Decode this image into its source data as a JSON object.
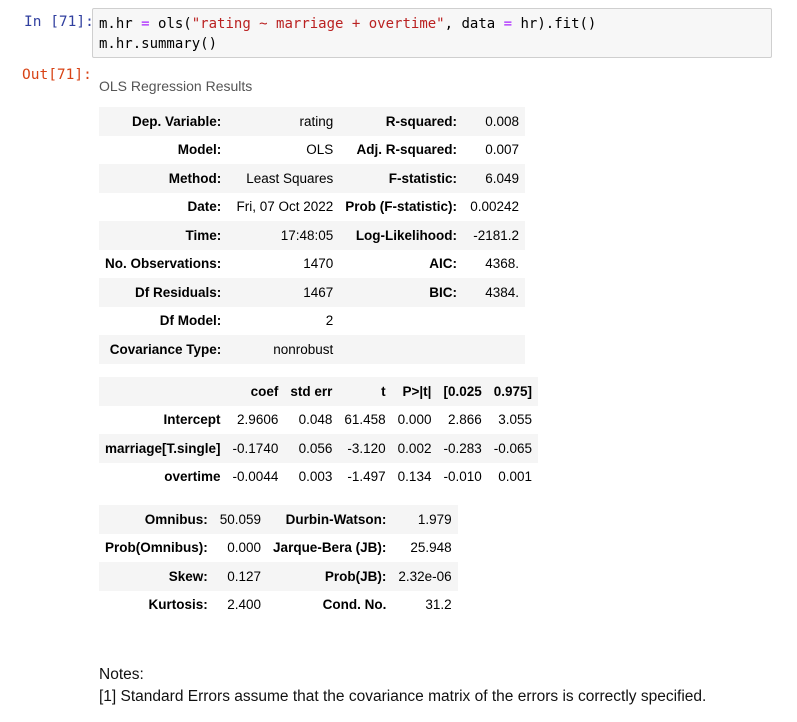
{
  "input_prompt": "In [71]:",
  "output_prompt": "Out[71]:",
  "code": {
    "line1_tokens": [
      {
        "t": "m.hr ",
        "c": "tk-plain"
      },
      {
        "t": "=",
        "c": "tk-op"
      },
      {
        "t": " ols(",
        "c": "tk-plain"
      },
      {
        "t": "\"rating ~ marriage + overtime\"",
        "c": "tk-str"
      },
      {
        "t": ", data ",
        "c": "tk-plain"
      },
      {
        "t": "=",
        "c": "tk-op"
      },
      {
        "t": " hr).fit()",
        "c": "tk-plain"
      }
    ],
    "line2": "m.hr.summary()"
  },
  "output_title": "OLS Regression Results",
  "summary_table": [
    [
      "Dep. Variable:",
      "rating",
      "R-squared:",
      "0.008"
    ],
    [
      "Model:",
      "OLS",
      "Adj. R-squared:",
      "0.007"
    ],
    [
      "Method:",
      "Least Squares",
      "F-statistic:",
      "6.049"
    ],
    [
      "Date:",
      "Fri, 07 Oct 2022",
      "Prob (F-statistic):",
      "0.00242"
    ],
    [
      "Time:",
      "17:48:05",
      "Log-Likelihood:",
      "-2181.2"
    ],
    [
      "No. Observations:",
      "1470",
      "AIC:",
      "4368."
    ],
    [
      "Df Residuals:",
      "1467",
      "BIC:",
      "4384."
    ],
    [
      "Df Model:",
      "2",
      "",
      ""
    ],
    [
      "Covariance Type:",
      "nonrobust",
      "",
      ""
    ]
  ],
  "coef_table": {
    "headers": [
      "",
      "coef",
      "std err",
      "t",
      "P>|t|",
      "[0.025",
      "0.975]"
    ],
    "rows": [
      [
        "Intercept",
        "2.9606",
        "0.048",
        "61.458",
        "0.000",
        "2.866",
        "3.055"
      ],
      [
        "marriage[T.single]",
        "-0.1740",
        "0.056",
        "-3.120",
        "0.002",
        "-0.283",
        "-0.065"
      ],
      [
        "overtime",
        "-0.0044",
        "0.003",
        "-1.497",
        "0.134",
        "-0.010",
        "0.001"
      ]
    ]
  },
  "diag_table": [
    [
      "Omnibus:",
      "50.059",
      "Durbin-Watson:",
      "1.979"
    ],
    [
      "Prob(Omnibus):",
      "0.000",
      "Jarque-Bera (JB):",
      "25.948"
    ],
    [
      "Skew:",
      "0.127",
      "Prob(JB):",
      "2.32e-06"
    ],
    [
      "Kurtosis:",
      "2.400",
      "Cond. No.",
      "31.2"
    ]
  ],
  "notes": {
    "heading": "Notes:",
    "line1": "[1] Standard Errors assume that the covariance matrix of the errors is correctly specified."
  }
}
